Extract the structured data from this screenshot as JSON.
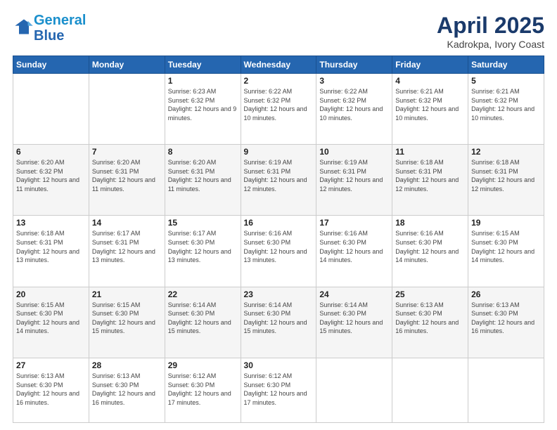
{
  "header": {
    "logo_line1": "General",
    "logo_line2": "Blue",
    "title": "April 2025",
    "subtitle": "Kadrokpa, Ivory Coast"
  },
  "days_of_week": [
    "Sunday",
    "Monday",
    "Tuesday",
    "Wednesday",
    "Thursday",
    "Friday",
    "Saturday"
  ],
  "weeks": [
    [
      {
        "day": "",
        "info": ""
      },
      {
        "day": "",
        "info": ""
      },
      {
        "day": "1",
        "info": "Sunrise: 6:23 AM\nSunset: 6:32 PM\nDaylight: 12 hours and 9 minutes."
      },
      {
        "day": "2",
        "info": "Sunrise: 6:22 AM\nSunset: 6:32 PM\nDaylight: 12 hours and 10 minutes."
      },
      {
        "day": "3",
        "info": "Sunrise: 6:22 AM\nSunset: 6:32 PM\nDaylight: 12 hours and 10 minutes."
      },
      {
        "day": "4",
        "info": "Sunrise: 6:21 AM\nSunset: 6:32 PM\nDaylight: 12 hours and 10 minutes."
      },
      {
        "day": "5",
        "info": "Sunrise: 6:21 AM\nSunset: 6:32 PM\nDaylight: 12 hours and 10 minutes."
      }
    ],
    [
      {
        "day": "6",
        "info": "Sunrise: 6:20 AM\nSunset: 6:32 PM\nDaylight: 12 hours and 11 minutes."
      },
      {
        "day": "7",
        "info": "Sunrise: 6:20 AM\nSunset: 6:31 PM\nDaylight: 12 hours and 11 minutes."
      },
      {
        "day": "8",
        "info": "Sunrise: 6:20 AM\nSunset: 6:31 PM\nDaylight: 12 hours and 11 minutes."
      },
      {
        "day": "9",
        "info": "Sunrise: 6:19 AM\nSunset: 6:31 PM\nDaylight: 12 hours and 12 minutes."
      },
      {
        "day": "10",
        "info": "Sunrise: 6:19 AM\nSunset: 6:31 PM\nDaylight: 12 hours and 12 minutes."
      },
      {
        "day": "11",
        "info": "Sunrise: 6:18 AM\nSunset: 6:31 PM\nDaylight: 12 hours and 12 minutes."
      },
      {
        "day": "12",
        "info": "Sunrise: 6:18 AM\nSunset: 6:31 PM\nDaylight: 12 hours and 12 minutes."
      }
    ],
    [
      {
        "day": "13",
        "info": "Sunrise: 6:18 AM\nSunset: 6:31 PM\nDaylight: 12 hours and 13 minutes."
      },
      {
        "day": "14",
        "info": "Sunrise: 6:17 AM\nSunset: 6:31 PM\nDaylight: 12 hours and 13 minutes."
      },
      {
        "day": "15",
        "info": "Sunrise: 6:17 AM\nSunset: 6:30 PM\nDaylight: 12 hours and 13 minutes."
      },
      {
        "day": "16",
        "info": "Sunrise: 6:16 AM\nSunset: 6:30 PM\nDaylight: 12 hours and 13 minutes."
      },
      {
        "day": "17",
        "info": "Sunrise: 6:16 AM\nSunset: 6:30 PM\nDaylight: 12 hours and 14 minutes."
      },
      {
        "day": "18",
        "info": "Sunrise: 6:16 AM\nSunset: 6:30 PM\nDaylight: 12 hours and 14 minutes."
      },
      {
        "day": "19",
        "info": "Sunrise: 6:15 AM\nSunset: 6:30 PM\nDaylight: 12 hours and 14 minutes."
      }
    ],
    [
      {
        "day": "20",
        "info": "Sunrise: 6:15 AM\nSunset: 6:30 PM\nDaylight: 12 hours and 14 minutes."
      },
      {
        "day": "21",
        "info": "Sunrise: 6:15 AM\nSunset: 6:30 PM\nDaylight: 12 hours and 15 minutes."
      },
      {
        "day": "22",
        "info": "Sunrise: 6:14 AM\nSunset: 6:30 PM\nDaylight: 12 hours and 15 minutes."
      },
      {
        "day": "23",
        "info": "Sunrise: 6:14 AM\nSunset: 6:30 PM\nDaylight: 12 hours and 15 minutes."
      },
      {
        "day": "24",
        "info": "Sunrise: 6:14 AM\nSunset: 6:30 PM\nDaylight: 12 hours and 15 minutes."
      },
      {
        "day": "25",
        "info": "Sunrise: 6:13 AM\nSunset: 6:30 PM\nDaylight: 12 hours and 16 minutes."
      },
      {
        "day": "26",
        "info": "Sunrise: 6:13 AM\nSunset: 6:30 PM\nDaylight: 12 hours and 16 minutes."
      }
    ],
    [
      {
        "day": "27",
        "info": "Sunrise: 6:13 AM\nSunset: 6:30 PM\nDaylight: 12 hours and 16 minutes."
      },
      {
        "day": "28",
        "info": "Sunrise: 6:13 AM\nSunset: 6:30 PM\nDaylight: 12 hours and 16 minutes."
      },
      {
        "day": "29",
        "info": "Sunrise: 6:12 AM\nSunset: 6:30 PM\nDaylight: 12 hours and 17 minutes."
      },
      {
        "day": "30",
        "info": "Sunrise: 6:12 AM\nSunset: 6:30 PM\nDaylight: 12 hours and 17 minutes."
      },
      {
        "day": "",
        "info": ""
      },
      {
        "day": "",
        "info": ""
      },
      {
        "day": "",
        "info": ""
      }
    ]
  ]
}
